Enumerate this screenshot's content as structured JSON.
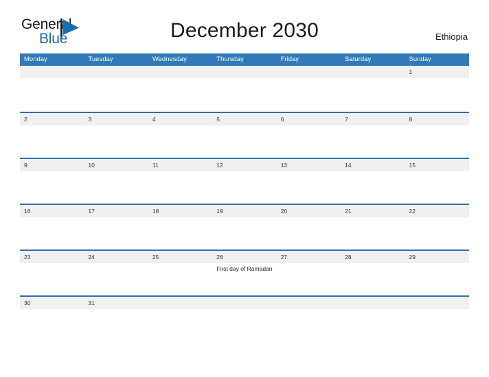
{
  "brand": {
    "line1": "General",
    "line2": "Blue",
    "flag_icon": "blue-triangle-flag",
    "color_dark": "#1a1a1a",
    "color_blue": "#1b6cb0"
  },
  "header": {
    "title": "December 2030",
    "country": "Ethiopia"
  },
  "theme": {
    "header_blue": "#3279b8",
    "row_divider_blue": "#2f6fad",
    "date_band_gray": "#f0f0f0",
    "page_background": "#ffffff",
    "text_color": "#222222"
  },
  "calendar": {
    "month": "December",
    "year": "2030",
    "week_start": "Monday",
    "weekdays": [
      "Monday",
      "Tuesday",
      "Wednesday",
      "Thursday",
      "Friday",
      "Saturday",
      "Sunday"
    ],
    "weeks": [
      {
        "days": [
          {
            "num": "",
            "empty": true,
            "events": []
          },
          {
            "num": "",
            "empty": true,
            "events": []
          },
          {
            "num": "",
            "empty": true,
            "events": []
          },
          {
            "num": "",
            "empty": true,
            "events": []
          },
          {
            "num": "",
            "empty": true,
            "events": []
          },
          {
            "num": "",
            "empty": true,
            "events": []
          },
          {
            "num": "1",
            "empty": false,
            "events": []
          }
        ]
      },
      {
        "days": [
          {
            "num": "2",
            "empty": false,
            "events": []
          },
          {
            "num": "3",
            "empty": false,
            "events": []
          },
          {
            "num": "4",
            "empty": false,
            "events": []
          },
          {
            "num": "5",
            "empty": false,
            "events": []
          },
          {
            "num": "6",
            "empty": false,
            "events": []
          },
          {
            "num": "7",
            "empty": false,
            "events": []
          },
          {
            "num": "8",
            "empty": false,
            "events": []
          }
        ]
      },
      {
        "days": [
          {
            "num": "9",
            "empty": false,
            "events": []
          },
          {
            "num": "10",
            "empty": false,
            "events": []
          },
          {
            "num": "11",
            "empty": false,
            "events": []
          },
          {
            "num": "12",
            "empty": false,
            "events": []
          },
          {
            "num": "13",
            "empty": false,
            "events": []
          },
          {
            "num": "14",
            "empty": false,
            "events": []
          },
          {
            "num": "15",
            "empty": false,
            "events": []
          }
        ]
      },
      {
        "days": [
          {
            "num": "16",
            "empty": false,
            "events": []
          },
          {
            "num": "17",
            "empty": false,
            "events": []
          },
          {
            "num": "18",
            "empty": false,
            "events": []
          },
          {
            "num": "19",
            "empty": false,
            "events": []
          },
          {
            "num": "20",
            "empty": false,
            "events": []
          },
          {
            "num": "21",
            "empty": false,
            "events": []
          },
          {
            "num": "22",
            "empty": false,
            "events": []
          }
        ]
      },
      {
        "days": [
          {
            "num": "23",
            "empty": false,
            "events": []
          },
          {
            "num": "24",
            "empty": false,
            "events": []
          },
          {
            "num": "25",
            "empty": false,
            "events": []
          },
          {
            "num": "26",
            "empty": false,
            "events": [
              "First day of Ramadan"
            ]
          },
          {
            "num": "27",
            "empty": false,
            "events": []
          },
          {
            "num": "28",
            "empty": false,
            "events": []
          },
          {
            "num": "29",
            "empty": false,
            "events": []
          }
        ]
      },
      {
        "days": [
          {
            "num": "30",
            "empty": false,
            "events": []
          },
          {
            "num": "31",
            "empty": false,
            "events": []
          },
          {
            "num": "",
            "empty": true,
            "events": []
          },
          {
            "num": "",
            "empty": true,
            "events": []
          },
          {
            "num": "",
            "empty": true,
            "events": []
          },
          {
            "num": "",
            "empty": true,
            "events": []
          },
          {
            "num": "",
            "empty": true,
            "events": []
          }
        ]
      }
    ]
  }
}
